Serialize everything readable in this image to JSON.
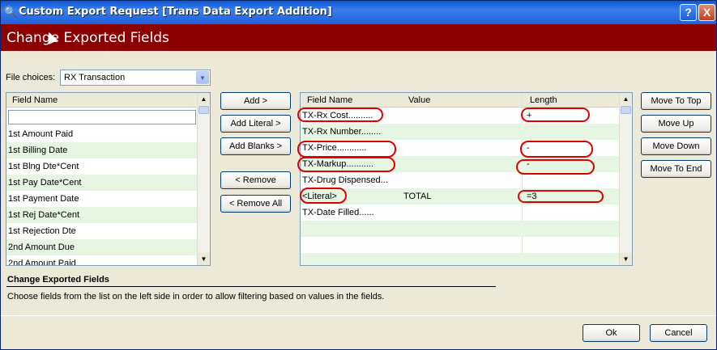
{
  "window": {
    "title": "Custom Export Request [Trans Data Export Addition]",
    "help_button": "?",
    "close_button": "X"
  },
  "banner": {
    "title": "Change Exported Fields"
  },
  "file_choices": {
    "label": "File choices:",
    "selected": "RX Transaction"
  },
  "left_list": {
    "header": "Field Name",
    "filter_value": "",
    "items": [
      "1st Amount Paid",
      "1st Billing Date",
      "1st Blng Dte*Cent",
      "1st Pay Date*Cent",
      "1st Payment Date",
      "1st Rej Date*Cent",
      "1st Rejection Dte",
      "2nd Amount Due",
      "2nd Amount Paid"
    ]
  },
  "middle_buttons": {
    "add": "Add >",
    "add_literal": "Add Literal >",
    "add_blanks": "Add Blanks >",
    "remove": "< Remove",
    "remove_all": "< Remove All"
  },
  "export_grid": {
    "headers": {
      "field_name": "Field Name",
      "value": "Value",
      "length": "Length"
    },
    "rows": [
      {
        "field": "TX-Rx Cost..........",
        "value": "",
        "length": "+"
      },
      {
        "field": "TX-Rx Number........",
        "value": "",
        "length": ""
      },
      {
        "field": "TX-Price............",
        "value": "",
        "length": "-"
      },
      {
        "field": "TX-Markup...........",
        "value": "",
        "length": "-"
      },
      {
        "field": "TX-Drug Dispensed...",
        "value": "",
        "length": ""
      },
      {
        "field": "<Literal>",
        "value": "TOTAL",
        "length": "=3"
      },
      {
        "field": "TX-Date Filled......",
        "value": "",
        "length": ""
      },
      {
        "field": "",
        "value": "",
        "length": ""
      },
      {
        "field": "",
        "value": "",
        "length": ""
      },
      {
        "field": "",
        "value": "",
        "length": ""
      }
    ]
  },
  "right_buttons": {
    "move_top": "Move To Top",
    "move_up": "Move Up",
    "move_down": "Move Down",
    "move_end": "Move To End"
  },
  "description": {
    "title": "Change Exported Fields",
    "text": "Choose fields from the list on the left side in order to allow filtering based on values in the fields."
  },
  "footer": {
    "ok": "Ok",
    "cancel": "Cancel"
  },
  "colors": {
    "banner": "#8b0000",
    "highlight_oval": "#e00000",
    "alt_row": "#e6f6e2"
  }
}
